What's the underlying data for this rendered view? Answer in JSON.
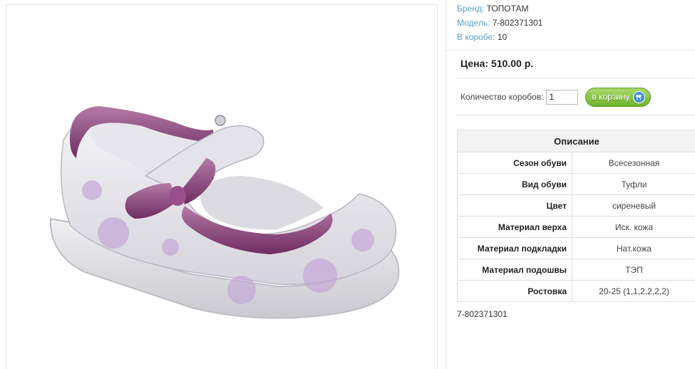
{
  "product_image": {
    "icon": "shoe-image",
    "description_alt": "girl's mary-jane shoe"
  },
  "meta": {
    "brand_label": "Бренд:",
    "brand_value": "ТОПОТАМ",
    "model_label": "Модель:",
    "model_value": "7-802371301",
    "box_label": "В коробе:",
    "box_value": "10"
  },
  "price": "Цена: 510.00 р.",
  "quantity": {
    "label": "Количество коробов:",
    "value": "1"
  },
  "cart_button": {
    "label": "в корзину",
    "icon": "cart-icon"
  },
  "spec_table": {
    "title": "Описание",
    "rows": [
      {
        "key": "Сезон обуви",
        "value": "Всесезонная"
      },
      {
        "key": "Вид обуви",
        "value": "Туфли"
      },
      {
        "key": "Цвет",
        "value": "сиреневый"
      },
      {
        "key": "Материал верха",
        "value": "Иск. кожа"
      },
      {
        "key": "Материал подкладки",
        "value": "Нат.кожа"
      },
      {
        "key": "Материал подошвы",
        "value": "ТЭП"
      },
      {
        "key": "Ростовка",
        "value": "20-25 (1,1,2,2,2,2)"
      }
    ]
  },
  "sku_footer": "7-802371301",
  "colors": {
    "link_blue": "#5a9fcf",
    "button_green": "#6fb22c",
    "shoe_purple": "#8a3f7a"
  }
}
